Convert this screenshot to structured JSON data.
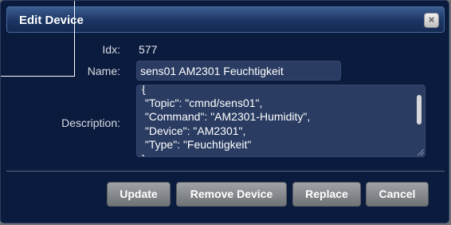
{
  "dialog": {
    "title": "Edit Device",
    "close_symbol": "×",
    "close_icon": "close-icon"
  },
  "fields": {
    "idx_label": "Idx:",
    "idx_value": "577",
    "name_label": "Name:",
    "name_value": "sens01 AM2301 Feuchtigkeit",
    "description_label": "Description:",
    "description_value": "{\n \"Topic\": \"cmnd/sens01\",\n \"Command\": \"AM2301-Humidity\",\n \"Device\": \"AM2301\",\n \"Type\": \"Feuchtigkeit\"\n}"
  },
  "buttons": {
    "update": "Update",
    "remove_device": "Remove Device",
    "replace": "Replace",
    "cancel": "Cancel"
  },
  "colors": {
    "background": "#0b1b3e",
    "title_bar": "#1b3563",
    "input_bg": "#2a3c62",
    "button": "#8a8e92"
  }
}
